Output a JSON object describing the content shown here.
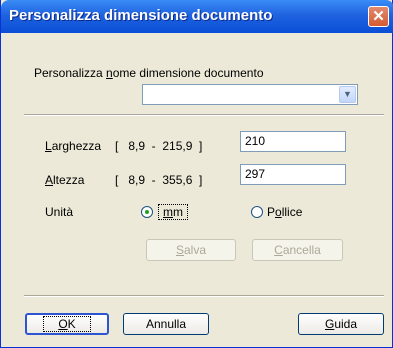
{
  "dialog": {
    "title": "Personalizza dimensione documento",
    "close_glyph": "✕"
  },
  "name_section": {
    "label_pre": "Personalizza ",
    "label_accel": "n",
    "label_post": "ome dimensione documento",
    "combo_value": ""
  },
  "width_row": {
    "label_accel": "L",
    "label_rest": "arghezza",
    "range": "[   8,9  -  215,9  ]",
    "value": "210"
  },
  "height_row": {
    "label_accel": "A",
    "label_rest": "ltezza",
    "range": "[   8,9  -  355,6  ]",
    "value": "297"
  },
  "unit": {
    "label": "Unità",
    "mm_accel": "m",
    "mm_rest": "m",
    "mm_selected": true,
    "inch_pre": "P",
    "inch_accel": "o",
    "inch_rest": "llice",
    "inch_selected": false
  },
  "actions": {
    "save_accel": "S",
    "save_rest": "alva",
    "delete_accel": "C",
    "delete_rest": "ancella"
  },
  "footer": {
    "ok_accel": "O",
    "ok_rest": "K",
    "cancel_label": "Annulla",
    "help_accel": "G",
    "help_rest": "uida"
  }
}
